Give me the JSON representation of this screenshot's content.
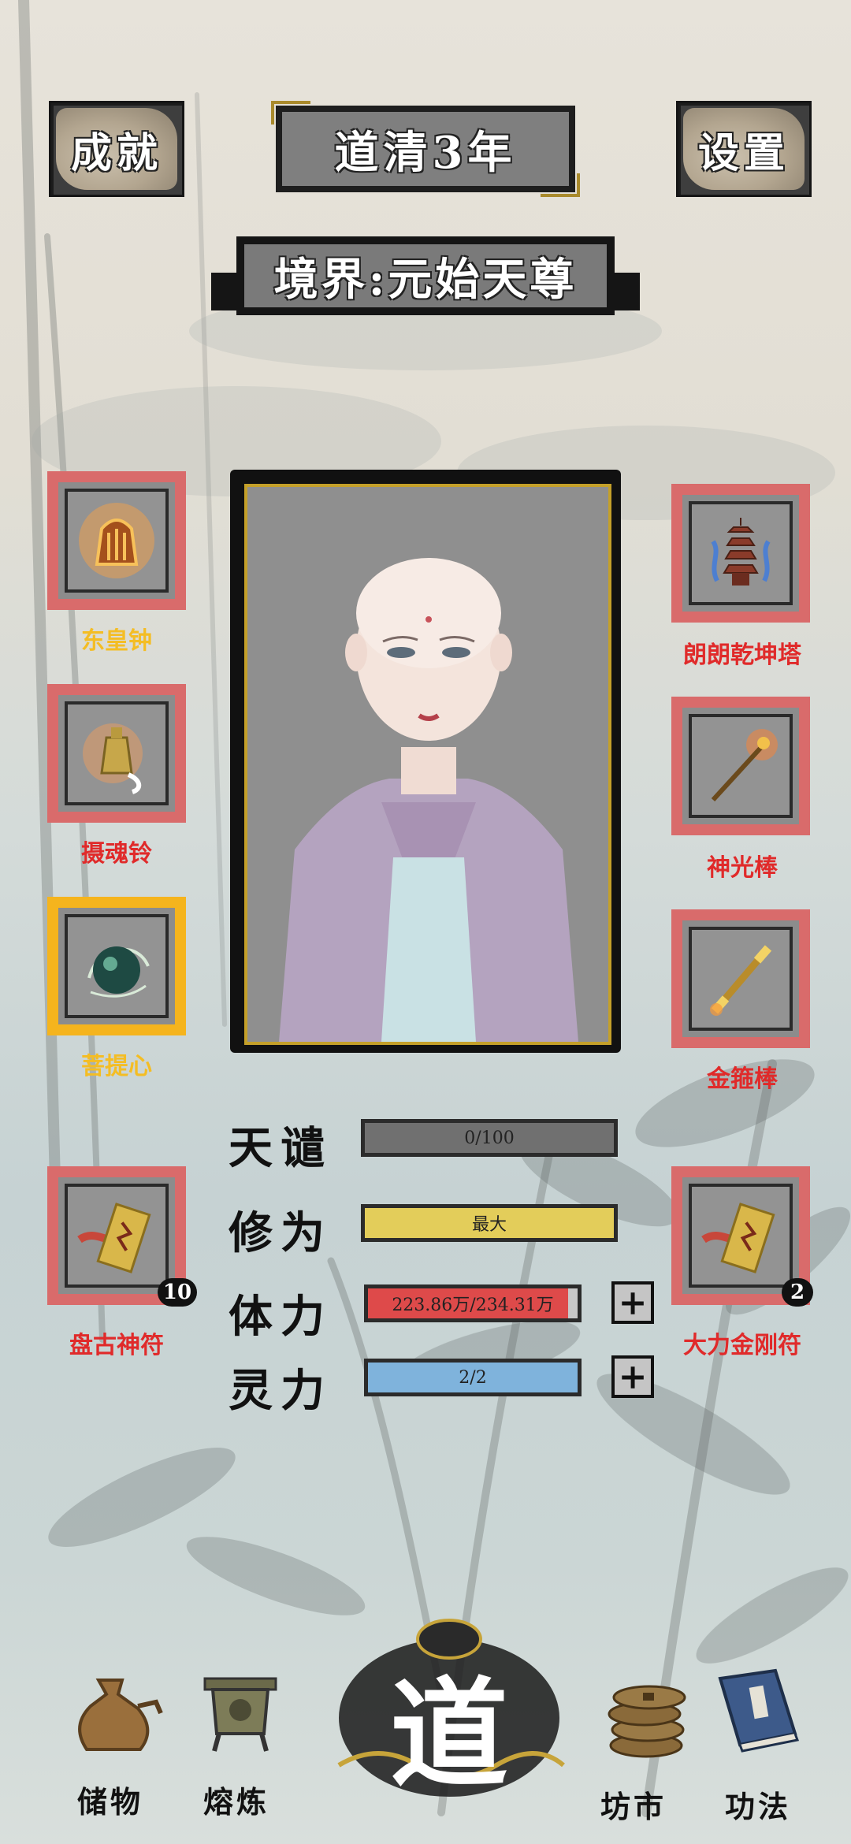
{
  "header": {
    "achievements_label": "成就",
    "settings_label": "设置",
    "year_label": "道清3年",
    "realm_label": "境界:元始天尊"
  },
  "equipment_left": [
    {
      "name": "东皇钟",
      "rarity": "gold",
      "icon": "bell-artifact-icon"
    },
    {
      "name": "摄魂铃",
      "rarity": "red",
      "icon": "soul-bell-icon"
    },
    {
      "name": "菩提心",
      "rarity": "gold",
      "icon": "bodhi-orb-icon"
    }
  ],
  "equipment_right": [
    {
      "name": "朗朗乾坤塔",
      "rarity": "red",
      "icon": "pagoda-icon"
    },
    {
      "name": "神光棒",
      "rarity": "red",
      "icon": "light-staff-icon"
    },
    {
      "name": "金箍棒",
      "rarity": "red",
      "icon": "golden-staff-icon"
    }
  ],
  "talismans": [
    {
      "name": "盘古神符",
      "count": "10",
      "icon": "talisman-icon"
    },
    {
      "name": "大力金刚符",
      "count": "2",
      "icon": "talisman-icon"
    }
  ],
  "stats": {
    "tribulation": {
      "label": "天谴",
      "value": "0/100",
      "fill": 0.0,
      "color": "#6f6f6f"
    },
    "cultivation": {
      "label": "修为",
      "value": "最大",
      "fill": 1.0,
      "color": "#e3cd5a"
    },
    "stamina": {
      "label": "体力",
      "value": "223.86万/234.31万",
      "fill": 0.955,
      "color": "#de4a4a"
    },
    "spirit": {
      "label": "灵力",
      "value": "2/2",
      "fill": 1.0,
      "color": "#7fb3dc"
    }
  },
  "plus_symbol": "+",
  "nav": {
    "storage": "储物",
    "smelt": "熔炼",
    "dao": "道",
    "market": "坊市",
    "techniques": "功法"
  },
  "colors": {
    "rarity_gold": "#f5b41d",
    "rarity_red": "#d96b6b"
  }
}
